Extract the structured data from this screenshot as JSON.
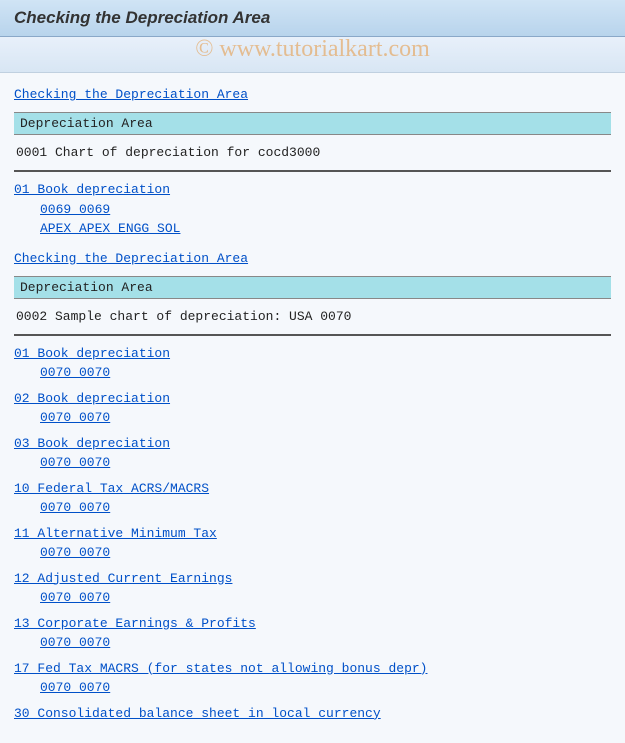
{
  "watermark": "© www.tutorialkart.com",
  "title": "Checking the Depreciation Area",
  "blocks": [
    {
      "link_header": "Checking the Depreciation Area",
      "section_label": "Depreciation Area",
      "chart_title": "0001 Chart of depreciation for cocd3000",
      "areas": [
        {
          "line": "01 Book depreciation",
          "subs": [
            "0069 0069",
            "APEX APEX ENGG SOL"
          ]
        }
      ]
    },
    {
      "link_header": "Checking the Depreciation Area",
      "section_label": "Depreciation Area",
      "chart_title": "0002 Sample chart of depreciation: USA 0070",
      "areas": [
        {
          "line": "01 Book depreciation",
          "subs": [
            "0070 0070"
          ]
        },
        {
          "line": "02 Book depreciation",
          "subs": [
            "0070 0070"
          ]
        },
        {
          "line": "03 Book depreciation",
          "subs": [
            "0070 0070"
          ]
        },
        {
          "line": "10 Federal Tax ACRS/MACRS",
          "subs": [
            "0070 0070"
          ]
        },
        {
          "line": "11 Alternative Minimum Tax",
          "subs": [
            "0070 0070"
          ]
        },
        {
          "line": "12 Adjusted Current Earnings",
          "subs": [
            "0070 0070"
          ]
        },
        {
          "line": "13 Corporate Earnings & Profits",
          "subs": [
            "0070 0070"
          ]
        },
        {
          "line": "17 Fed Tax MACRS (for states not allowing bonus depr)",
          "subs": [
            "0070 0070"
          ]
        },
        {
          "line": "30 Consolidated balance sheet in local currency",
          "subs": []
        }
      ]
    }
  ]
}
